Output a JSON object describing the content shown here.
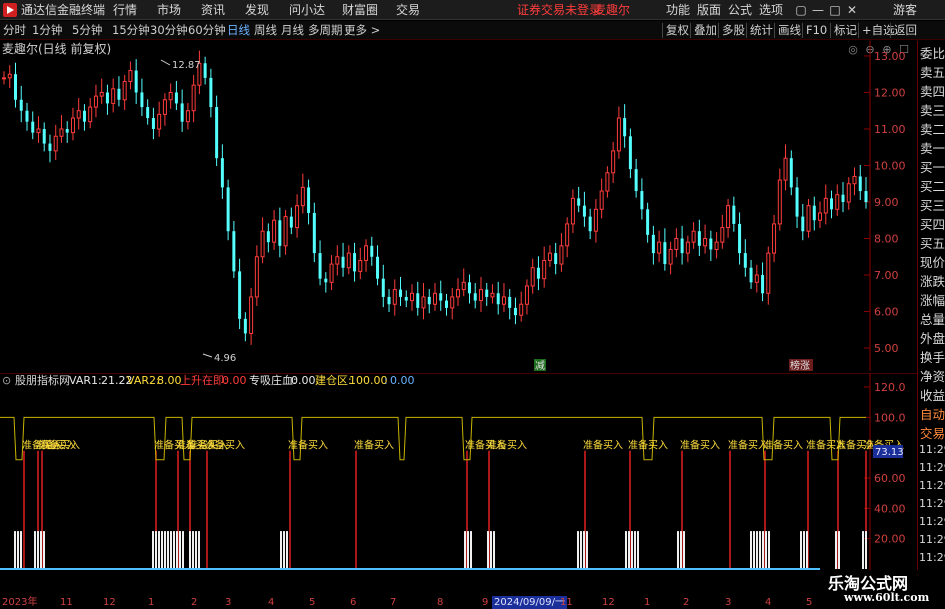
{
  "app": {
    "title": "通达信金融终端",
    "menu": [
      "行情",
      "市场",
      "资讯",
      "发现",
      "问小达",
      "财富圈",
      "交易"
    ],
    "warning": "证券交易未登录",
    "stock_name": "麦趣尔",
    "right_menu": [
      "功能",
      "版面",
      "公式",
      "选项"
    ],
    "user": "游客",
    "window_buttons": [
      "▢",
      "—",
      "□",
      "✕"
    ]
  },
  "periods": {
    "items": [
      "分时",
      "1分钟",
      "5分钟",
      "15分钟",
      "30分钟",
      "60分钟",
      "日线",
      "周线",
      "月线",
      "多周期",
      "更多 >"
    ],
    "active": "日线"
  },
  "toolbar": [
    "复权",
    "叠加",
    "多股",
    "统计",
    "画线",
    "F10",
    "标记",
    "+自选",
    "返回"
  ],
  "main_chart": {
    "title": "麦趣尔(日线 前复权)",
    "y_ticks": [
      "13.00",
      "12.00",
      "11.00",
      "10.00",
      "9.00",
      "8.00",
      "7.00",
      "6.00",
      "5.00"
    ],
    "high_label": "12.87",
    "low_label": "4.96",
    "marker_jian": "减",
    "marker_bang": "榜涨",
    "tools": [
      "◎",
      "⊖",
      "⊕",
      "☐"
    ]
  },
  "indicator": {
    "name": "股朋指标网",
    "var1_label": "VAR1:",
    "var1_value": "21.22",
    "var2_label": "VAR2:",
    "var2_value": "8.00",
    "up_label": "上升在即:",
    "up_value": "0.00",
    "absorb_label": "专吸庄血:",
    "absorb_value": "0.00",
    "build_label": "建仓区:",
    "build_value": "100.00",
    "extra_label": ":",
    "extra_value": "0.00",
    "y_ticks": [
      "120.0",
      "100.0",
      "60.00",
      "40.00",
      "20.00"
    ],
    "current_tag": "73.13",
    "signal_text": "准备买入"
  },
  "side_panel": {
    "items": [
      "委比",
      "卖五",
      "卖四",
      "卖三",
      "卖二",
      "卖一",
      "买一",
      "买二",
      "买三",
      "买四",
      "买五",
      "现价",
      "涨跌",
      "涨幅",
      "总量",
      "外盘",
      "换手",
      "净资",
      "收益",
      "自动",
      "交易"
    ],
    "times": [
      "11:29",
      "11:29",
      "11:29",
      "11:29",
      "11:29",
      "11:29",
      "11:29",
      "11:29",
      "11:29",
      "11:29"
    ]
  },
  "dates": {
    "labels": [
      "2023年",
      "11",
      "12",
      "1",
      "2",
      "3",
      "4",
      "5",
      "6",
      "7",
      "8",
      "9",
      "11",
      "12",
      "1",
      "2",
      "3",
      "4",
      "5"
    ],
    "selected": "2024/09/09/一"
  },
  "watermark": {
    "line1": "乐淘公式网",
    "line2": "www.60lt.com"
  },
  "colors": {
    "up": "#ff3c3c",
    "down": "#54ffff",
    "signal_line": "#c8b400",
    "axis": "#8b0000",
    "accent_blue": "#6ab0ff"
  },
  "chart_data": {
    "type": "candlestick",
    "ylim": [
      4.7,
      13.3
    ],
    "series": [
      {
        "name": "price",
        "values": [
          12.4,
          12.5,
          11.8,
          11.5,
          11.2,
          10.9,
          11.0,
          10.6,
          10.4,
          10.8,
          11.0,
          10.9,
          11.3,
          11.5,
          11.2,
          11.6,
          11.9,
          12.0,
          11.7,
          12.1,
          11.8,
          12.3,
          12.6,
          12.0,
          11.6,
          11.3,
          11.0,
          11.4,
          11.8,
          12.0,
          11.7,
          11.2,
          11.5,
          12.2,
          12.8,
          12.4,
          11.6,
          10.2,
          9.4,
          8.2,
          7.1,
          5.8,
          5.4,
          6.4,
          7.5,
          8.2,
          7.9,
          8.5,
          7.8,
          8.6,
          8.3,
          8.9,
          9.4,
          8.7,
          7.6,
          6.9,
          6.8,
          7.3,
          7.5,
          7.2,
          7.6,
          7.1,
          7.4,
          7.8,
          7.5,
          6.9,
          6.4,
          6.2,
          6.6,
          6.4,
          6.3,
          6.5,
          6.1,
          6.4,
          6.2,
          6.5,
          6.3,
          6.1,
          6.4,
          6.6,
          6.8,
          6.5,
          6.3,
          6.6,
          6.4,
          6.5,
          6.2,
          6.4,
          6.1,
          5.9,
          6.2,
          6.7,
          7.2,
          6.9,
          7.4,
          7.6,
          7.3,
          7.8,
          8.4,
          9.1,
          8.9,
          8.6,
          8.2,
          8.8,
          9.3,
          9.8,
          10.4,
          11.3,
          10.8,
          9.9,
          9.3,
          8.8,
          8.1,
          7.6,
          7.9,
          7.3,
          7.7,
          8.0,
          7.6,
          7.9,
          8.2,
          7.8,
          8.0,
          7.7,
          7.9,
          8.3,
          8.9,
          8.4,
          7.6,
          7.2,
          6.8,
          7.0,
          6.5,
          7.6,
          8.4,
          9.6,
          10.2,
          9.4,
          8.6,
          8.2,
          8.9,
          8.5,
          8.7,
          9.1,
          8.8,
          9.2,
          9.0,
          9.5,
          9.7,
          9.3,
          9.0
        ]
      }
    ]
  }
}
